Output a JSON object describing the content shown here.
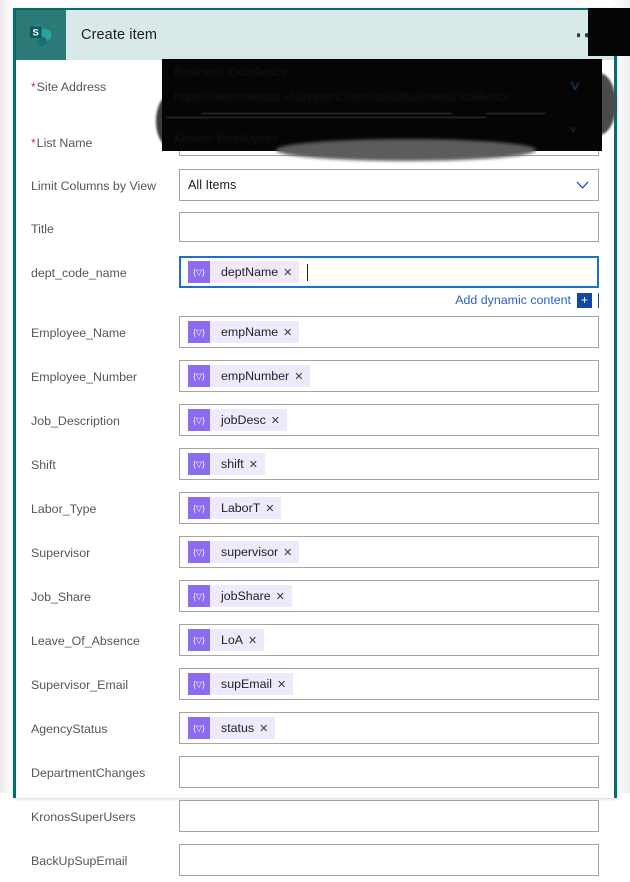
{
  "card": {
    "app_icon_name": "sharepoint-icon",
    "title": "Create item",
    "overflow_menu_label": "···",
    "accent_color": "#036c70",
    "header_bg": "#d9e8e8",
    "icon_bg": "#2b7a78"
  },
  "theme": {
    "token_icon_bg": "#8b6cef",
    "token_chip_bg": "#eee9fb",
    "focus_border": "#1f6fd0",
    "link_color": "#2a5fc9",
    "required_star_color": "#d13438",
    "label_color": "#565656"
  },
  "add_dynamic_content": {
    "label": "Add dynamic content",
    "plus_label": "+"
  },
  "redaction": {
    "ghost_line_1": "Business Excellence",
    "ghost_line_2": "https://metronetusa.sharepoint.com/sites/BusinessExcellence",
    "ghost_line_3": "Kronos Employees"
  },
  "fields": [
    {
      "label": "Site Address",
      "required": true,
      "type": "combobox",
      "value": "",
      "redacted": true,
      "name": "site-address"
    },
    {
      "label": "List Name",
      "required": true,
      "type": "combobox",
      "value": "",
      "redacted": true,
      "name": "list-name"
    },
    {
      "label": "Limit Columns by View",
      "required": false,
      "type": "combobox",
      "value": "All Items",
      "redacted": false,
      "name": "limit-columns-by-view"
    },
    {
      "label": "Title",
      "required": false,
      "type": "text",
      "value": "",
      "redacted": false,
      "name": "title"
    },
    {
      "label": "dept_code_name",
      "required": false,
      "type": "token",
      "token": "deptName",
      "focused": true,
      "redacted": false,
      "name": "dept-code-name"
    },
    {
      "label": "Employee_Name",
      "required": false,
      "type": "token",
      "token": "empName",
      "focused": false,
      "redacted": false,
      "name": "employee-name"
    },
    {
      "label": "Employee_Number",
      "required": false,
      "type": "token",
      "token": "empNumber",
      "focused": false,
      "redacted": false,
      "name": "employee-number"
    },
    {
      "label": "Job_Description",
      "required": false,
      "type": "token",
      "token": "jobDesc",
      "focused": false,
      "redacted": false,
      "name": "job-description"
    },
    {
      "label": "Shift",
      "required": false,
      "type": "token",
      "token": "shift",
      "focused": false,
      "redacted": false,
      "name": "shift"
    },
    {
      "label": "Labor_Type",
      "required": false,
      "type": "token",
      "token": "LaborT",
      "focused": false,
      "redacted": false,
      "name": "labor-type"
    },
    {
      "label": "Supervisor",
      "required": false,
      "type": "token",
      "token": "supervisor",
      "focused": false,
      "redacted": false,
      "name": "supervisor"
    },
    {
      "label": "Job_Share",
      "required": false,
      "type": "token",
      "token": "jobShare",
      "focused": false,
      "redacted": false,
      "name": "job-share"
    },
    {
      "label": "Leave_Of_Absence",
      "required": false,
      "type": "token",
      "token": "LoA",
      "focused": false,
      "redacted": false,
      "name": "leave-of-absence"
    },
    {
      "label": "Supervisor_Email",
      "required": false,
      "type": "token",
      "token": "supEmail",
      "focused": false,
      "redacted": false,
      "name": "supervisor-email"
    },
    {
      "label": "AgencyStatus",
      "required": false,
      "type": "token",
      "token": "status",
      "focused": false,
      "redacted": false,
      "name": "agency-status"
    },
    {
      "label": "DepartmentChanges",
      "required": false,
      "type": "text",
      "value": "",
      "redacted": false,
      "name": "department-changes"
    },
    {
      "label": "KronosSuperUsers",
      "required": false,
      "type": "text",
      "value": "",
      "redacted": false,
      "name": "kronos-super-users"
    },
    {
      "label": "BackUpSupEmail",
      "required": false,
      "type": "text",
      "value": "",
      "redacted": false,
      "name": "backup-sup-email"
    }
  ]
}
